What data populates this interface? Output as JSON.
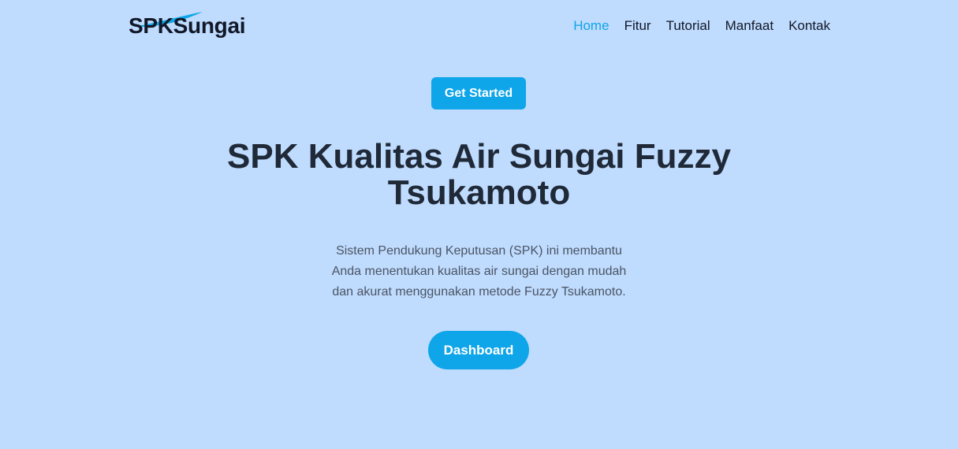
{
  "header": {
    "brand": "SPKSungai",
    "nav": [
      {
        "label": "Home",
        "active": true
      },
      {
        "label": "Fitur",
        "active": false
      },
      {
        "label": "Tutorial",
        "active": false
      },
      {
        "label": "Manfaat",
        "active": false
      },
      {
        "label": "Kontak",
        "active": false
      }
    ]
  },
  "hero": {
    "badge_label": "Get Started",
    "title_lines": [
      "SPK Kualitas Air Sungai Fuzzy",
      "Tsukamoto"
    ],
    "description_lines": [
      "Sistem Pendukung Keputusan (SPK) ini membantu",
      "Anda menentukan kualitas air sungai dengan mudah",
      "dan akurat menggunakan metode Fuzzy Tsukamoto."
    ],
    "cta_label": "Dashboard"
  },
  "colors": {
    "background": "#bfdbfe",
    "accent": "#0ea5e9",
    "text": "#1f2937",
    "muted_text": "#4b5563"
  },
  "icons": {
    "brand_swoosh": "swoosh-icon"
  }
}
